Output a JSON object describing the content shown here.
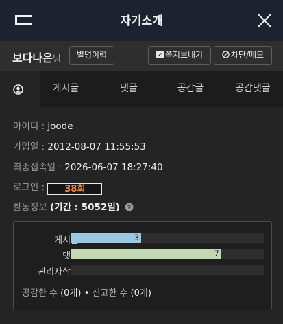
{
  "window": {
    "title": "자기소개",
    "accent_bg": "#1d2231"
  },
  "profile": {
    "nickname": "보다나은",
    "nickname_suffix": "님",
    "history_button": "별명이력",
    "message_button": "쪽지보내기",
    "block_button": "차단/메모"
  },
  "tabs": [
    {
      "icon": "user-circle-icon",
      "label": ""
    },
    {
      "label": "게시글"
    },
    {
      "label": "댓글"
    },
    {
      "label": "공감글"
    },
    {
      "label": "공감댓글"
    }
  ],
  "info": {
    "id_label": "아이디 : ",
    "id_value": "joode",
    "joined_label": "가입일 : ",
    "joined_value": "2012-08-07 11:55:53",
    "last_login_label": "최종접속일 : ",
    "last_login_value": "2026-06-07 18:27:40",
    "login_label": "로그인 : ",
    "login_value": "38회",
    "activity_label": "활동정보 ",
    "activity_value": "(기간 : 5052일)"
  },
  "stats": {
    "rows": [
      {
        "label": "게시글",
        "value": "3",
        "fraction": 0.365,
        "color": "#9ac8e2"
      },
      {
        "label": "댓글",
        "value": "7",
        "fraction": 0.78,
        "color": "#c2d8b2"
      },
      {
        "label": "관리자삭제",
        "value": "",
        "fraction": 0,
        "color": "#cccccc"
      }
    ],
    "liked_label": "공감한 수 ",
    "liked_value": "(0개)",
    "separator": " • ",
    "reported_label": "신고한 수 ",
    "reported_value": "(0개)"
  }
}
